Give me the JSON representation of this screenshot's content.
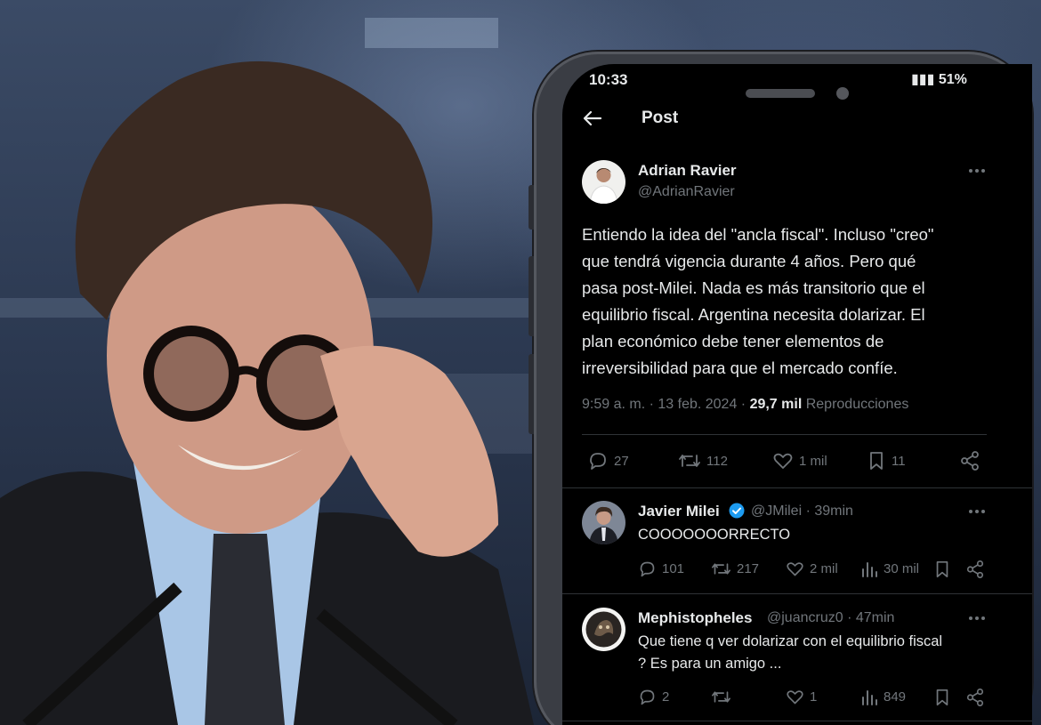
{
  "status_bar": {
    "time": "10:33",
    "battery": "51%"
  },
  "header": {
    "title": "Post"
  },
  "main_tweet": {
    "author_name": "Adrian Ravier",
    "author_handle": "@AdrianRavier",
    "text": "Entiendo la idea del \"ancla fiscal\". Incluso \"creo\"\nque tendrá vigencia durante 4 años. Pero qué\npasa post-Milei. Nada es más transitorio que el\nequilibrio fiscal. Argentina necesita dolarizar. El\nplan económico debe tener elementos de\nirreversibilidad para que el mercado confíe.",
    "time": "9:59 a. m.",
    "date": "13 feb. 2024",
    "views_count": "29,7 mil",
    "views_label": "Reproducciones",
    "replies": "27",
    "reposts": "112",
    "likes": "1 mil",
    "bookmarks": "11"
  },
  "replies": [
    {
      "author_name": "Javier Milei",
      "author_handle": "@JMilei",
      "age": "39min",
      "text": "COOOOOOORRECTO",
      "replies": "101",
      "reposts": "217",
      "likes": "2 mil",
      "views": "30 mil"
    },
    {
      "author_name": "Mephistopheles",
      "author_handle": "@juancruz0",
      "age": "47min",
      "text": "Que tiene q ver dolarizar con el equilibrio fiscal\n? Es para un amigo ...",
      "replies": "2",
      "reposts": "",
      "likes": "1",
      "views": "849"
    }
  ],
  "colors": {
    "background": "#000000",
    "text_primary": "#e7e9ea",
    "text_secondary": "#71767b",
    "divider": "#2f3336",
    "verified": "#1d9bf0"
  }
}
